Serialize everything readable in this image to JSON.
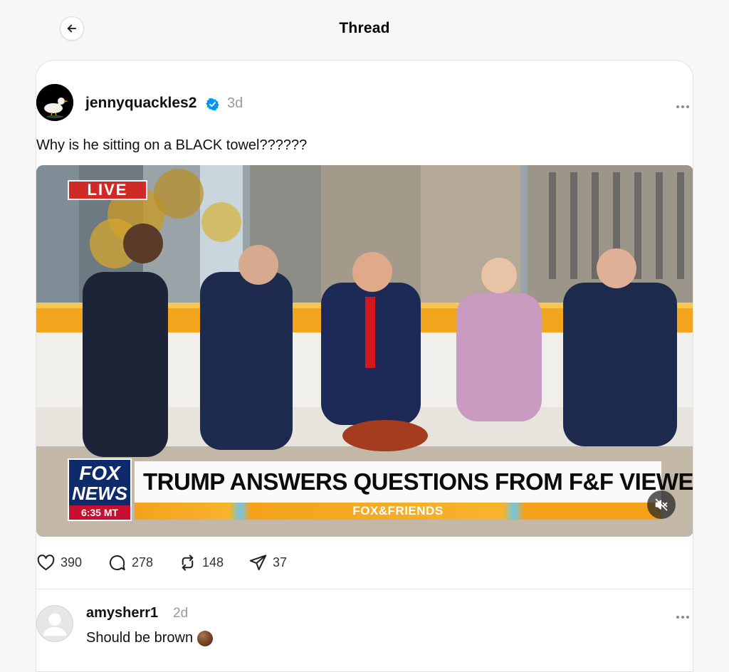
{
  "header": {
    "title": "Thread",
    "back_icon": "arrow-left-icon"
  },
  "post": {
    "username": "jennyquackles2",
    "verified": true,
    "timestamp": "3d",
    "text": "Why is he sitting on a BLACK towel??????",
    "more_icon": "more-horizontal-icon",
    "media": {
      "live_label": "LIVE",
      "network_line1": "FOX",
      "network_line2": "NEWS",
      "network_time": "6:35 MT",
      "headline": "TRUMP ANSWERS QUESTIONS FROM F&F VIEWERS",
      "show_name": "FOX&FRIENDS",
      "mute_icon": "speaker-muted-icon"
    },
    "actions": {
      "likes": "390",
      "comments": "278",
      "reposts": "148",
      "shares": "37"
    }
  },
  "reply": {
    "username": "amysherr1",
    "timestamp": "2d",
    "text": "Should be brown"
  },
  "colors": {
    "background": "#f7f7f7",
    "card": "#ffffff",
    "verified_blue": "#0095f6",
    "muted_text": "#9a9a9a",
    "live_red": "#d02a26",
    "fox_blue": "#0f2a6b"
  }
}
